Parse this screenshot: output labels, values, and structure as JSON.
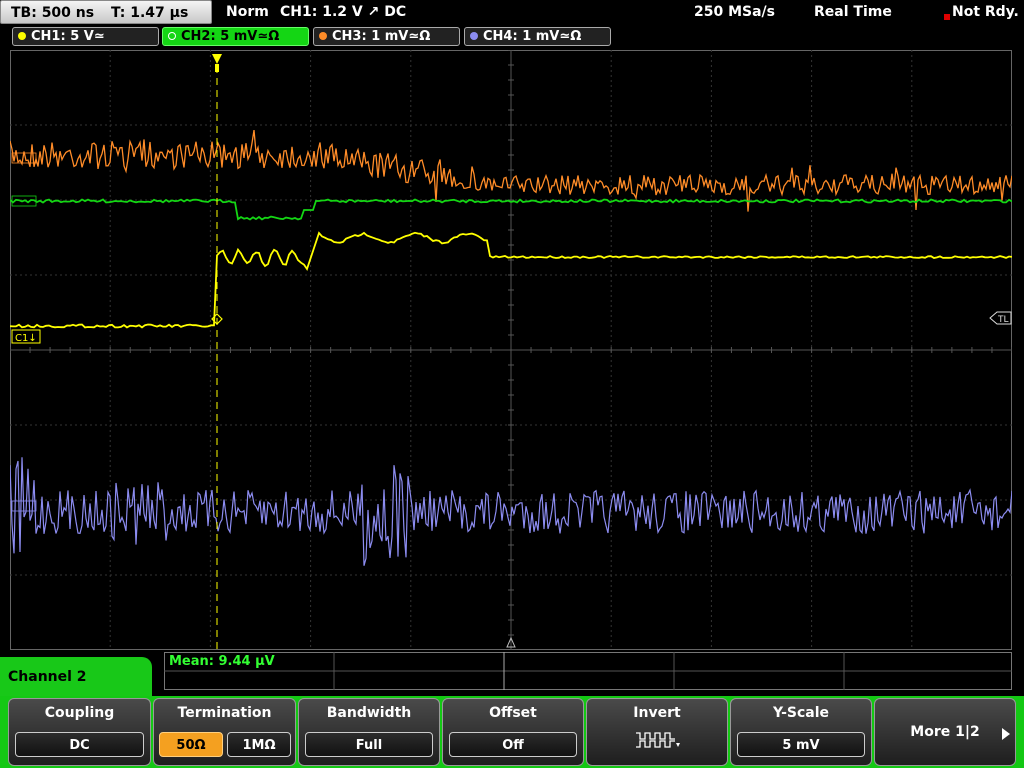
{
  "header": {
    "tb": "TB: 500 ns",
    "t": "T: 1.47 µs",
    "mode": "Norm",
    "trigger": "CH1: 1.2 V ↗ DC",
    "rate": "250 MSa/s",
    "acq": "Real Time",
    "status": "Not Rdy."
  },
  "channels": [
    {
      "label": "CH1: 5 V≃",
      "color": "#ffff00",
      "active": false
    },
    {
      "label": "CH2: 5 mV≃Ω",
      "color": "#14d614",
      "active": true
    },
    {
      "label": "CH3: 1 mV≃Ω",
      "color": "#ff8c28",
      "active": false
    },
    {
      "label": "CH4: 1 mV≃Ω",
      "color": "#8c8cf0",
      "active": false
    }
  ],
  "markers": {
    "c1": "C1↓",
    "tl": "TL"
  },
  "measurement": {
    "mean": "Mean: 9.44 µV"
  },
  "menu": {
    "channel_label": "Channel 2",
    "coupling": {
      "title": "Coupling",
      "value": "DC"
    },
    "termination": {
      "title": "Termination",
      "opt1": "50Ω",
      "opt2": "1MΩ"
    },
    "bandwidth": {
      "title": "Bandwidth",
      "value": "Full"
    },
    "offset": {
      "title": "Offset",
      "value": "Off"
    },
    "invert": {
      "title": "Invert"
    },
    "yscale": {
      "title": "Y-Scale",
      "value": "5 mV"
    },
    "more": {
      "label": "More 1|2"
    }
  },
  "colors": {
    "ch1": "#ffff00",
    "ch2": "#14d614",
    "ch3": "#ff8c28",
    "ch4": "#8c8cf0",
    "grid": "#3a3a3a"
  }
}
